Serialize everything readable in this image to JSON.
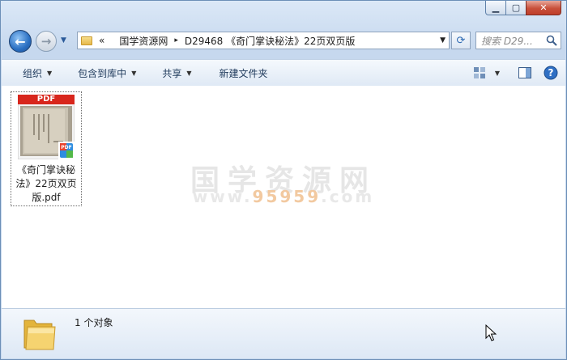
{
  "window": {
    "minimize_glyph": "▁",
    "maximize_glyph": "▢",
    "close_glyph": "✕"
  },
  "nav": {
    "back_glyph": "←",
    "forward_glyph": "→",
    "history_glyph": "▼"
  },
  "address": {
    "overflow": "«",
    "crumbs": [
      "国学资源网",
      "D29468 《奇门掌诀秘法》22页双页版"
    ],
    "separator": "▸",
    "dropdown_glyph": "▼"
  },
  "refresh_glyph": "⟳",
  "search": {
    "placeholder": "搜索 D29..."
  },
  "toolbar": {
    "organize": "组织",
    "include_in_library": "包含到库中",
    "share": "共享",
    "new_folder": "新建文件夹",
    "dropdown_glyph": "▼",
    "help_glyph": "?"
  },
  "files": [
    {
      "name_line1": "《奇门掌诀秘",
      "name_line2": "法》22页双页",
      "name_line3": "版.pdf",
      "badge": "PDF"
    }
  ],
  "watermark": {
    "line1": "国学资源网",
    "line2_prefix": "www.",
    "line2_highlight": "95959",
    "line2_suffix": ".com"
  },
  "details": {
    "count_text": "1 个对象"
  },
  "colors": {
    "accent": "#2a6fc2",
    "pdf_red": "#d8261c",
    "folder_yellow": "#f0c850"
  }
}
